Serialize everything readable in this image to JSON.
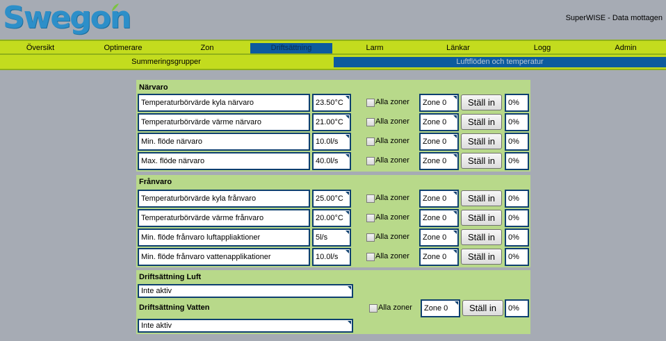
{
  "header": {
    "logo_text": "Swegon",
    "status": "SuperWISE - Data mottagen"
  },
  "nav": {
    "items": [
      "Översikt",
      "Optimerare",
      "Zon",
      "Driftsättning",
      "Larm",
      "Länkar",
      "Logg",
      "Admin"
    ],
    "active": "Driftsättning"
  },
  "subnav": {
    "items": [
      "Summeringsgrupper",
      "Luftflöden och temperatur"
    ],
    "active": "Luftflöden och temperatur"
  },
  "colors": {
    "nav_green": "#c3dc1e",
    "panel_green": "#b8d98a",
    "active_blue": "#0d5b9e",
    "brand_blue": "#2d8fc9",
    "background": "#a6abb4"
  },
  "narvaro": {
    "title": "Närvaro",
    "rows": [
      {
        "label": "Temperaturbörvärde kyla närvaro",
        "value": "23.50°C",
        "chk": "Alla zoner",
        "zone": "Zone 0",
        "button": "Ställ in",
        "pct": "0%"
      },
      {
        "label": "Temperaturbörvärde värme närvaro",
        "value": "21.00°C",
        "chk": "Alla zoner",
        "zone": "Zone 0",
        "button": "Ställ in",
        "pct": "0%"
      },
      {
        "label": "Min. flöde närvaro",
        "value": "10.0l/s",
        "chk": "Alla zoner",
        "zone": "Zone 0",
        "button": "Ställ in",
        "pct": "0%"
      },
      {
        "label": "Max. flöde närvaro",
        "value": "40.0l/s",
        "chk": "Alla zoner",
        "zone": "Zone 0",
        "button": "Ställ in",
        "pct": "0%"
      }
    ]
  },
  "franvaro": {
    "title": "Frånvaro",
    "rows": [
      {
        "label": "Temperaturbörvärde kyla frånvaro",
        "value": "25.00°C",
        "chk": "Alla zoner",
        "zone": "Zone 0",
        "button": "Ställ in",
        "pct": "0%"
      },
      {
        "label": "Temperaturbörvärde värme frånvaro",
        "value": "20.00°C",
        "chk": "Alla zoner",
        "zone": "Zone 0",
        "button": "Ställ in",
        "pct": "0%"
      },
      {
        "label": "Min. flöde frånvaro luftappliaktioner",
        "value": "5l/s",
        "chk": "Alla zoner",
        "zone": "Zone 0",
        "button": "Ställ in",
        "pct": "0%"
      },
      {
        "label": "Min. flöde frånvaro vattenapplikationer",
        "value": "10.0l/s",
        "chk": "Alla zoner",
        "zone": "Zone 0",
        "button": "Ställ in",
        "pct": "0%"
      }
    ]
  },
  "commissioning": {
    "luft_title": "Driftsättning Luft",
    "luft_value": "Inte aktiv",
    "vatten_title": "Driftsättning Vatten",
    "vatten_value": "Inte aktiv",
    "chk": "Alla zoner",
    "zone": "Zone 0",
    "button": "Ställ in",
    "pct": "0%"
  }
}
